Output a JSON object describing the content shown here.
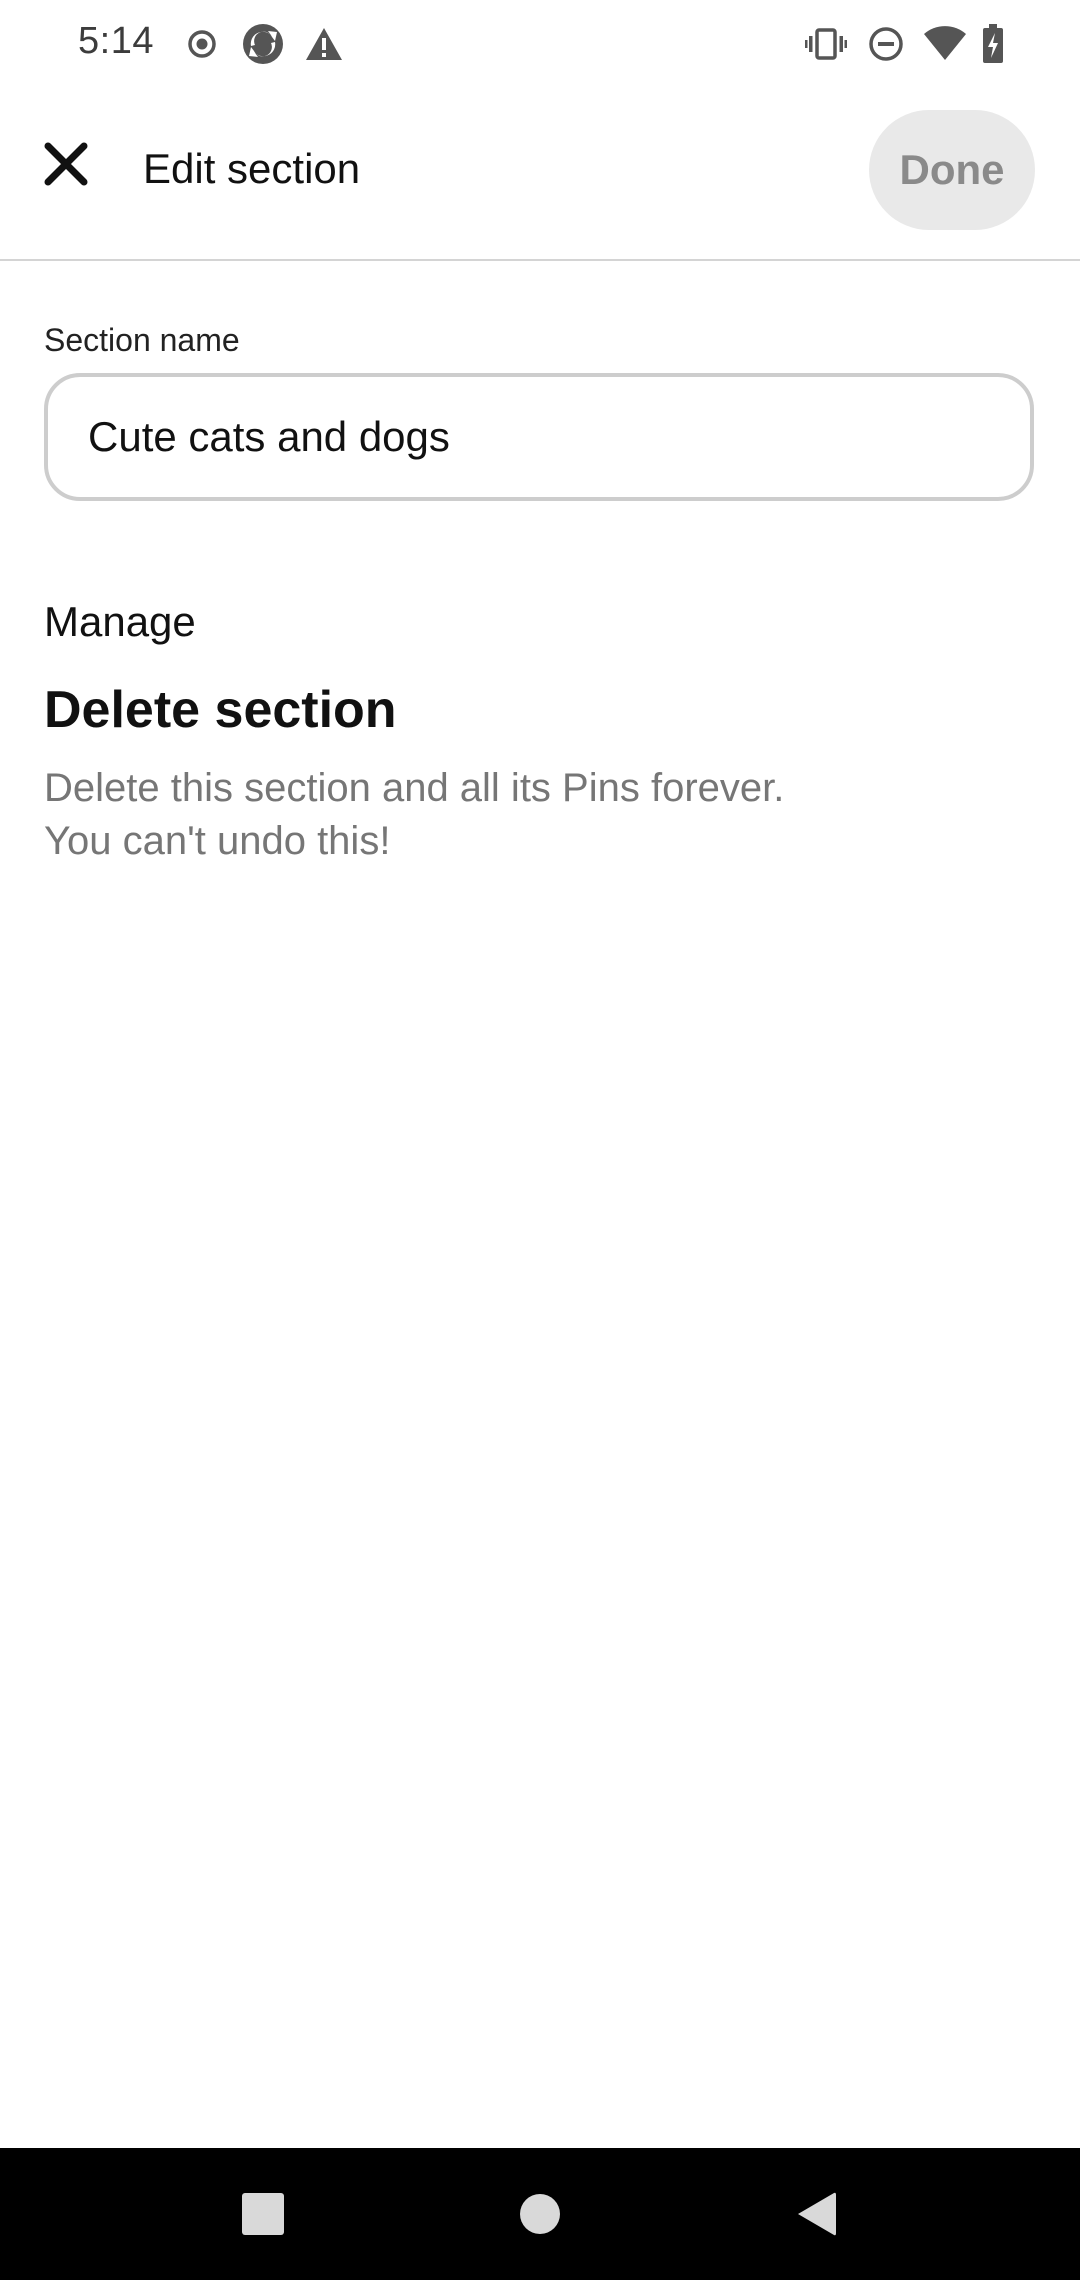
{
  "status_bar": {
    "time": "5:14",
    "left_icons": [
      "record-icon",
      "sync-icon",
      "warning-icon"
    ],
    "right_icons": [
      "vibrate-icon",
      "do-not-disturb-icon",
      "wifi-icon",
      "battery-charging-icon"
    ]
  },
  "app_bar": {
    "close_icon": "close-icon",
    "title": "Edit section",
    "done_label": "Done"
  },
  "form": {
    "section_name_label": "Section name",
    "section_name_value": "Cute cats and dogs"
  },
  "manage": {
    "heading": "Manage",
    "delete_title": "Delete section",
    "delete_description": "Delete this section and all its Pins forever.\nYou can't undo this!"
  },
  "nav_bar": {
    "buttons": [
      "recents-icon",
      "home-icon",
      "back-icon"
    ]
  },
  "colors": {
    "done_button_bg": "#e9e9e9",
    "done_button_text": "#8a8a8a",
    "description_text": "#767676",
    "input_border": "#cdcdcd",
    "nav_bar_bg": "#000000"
  }
}
